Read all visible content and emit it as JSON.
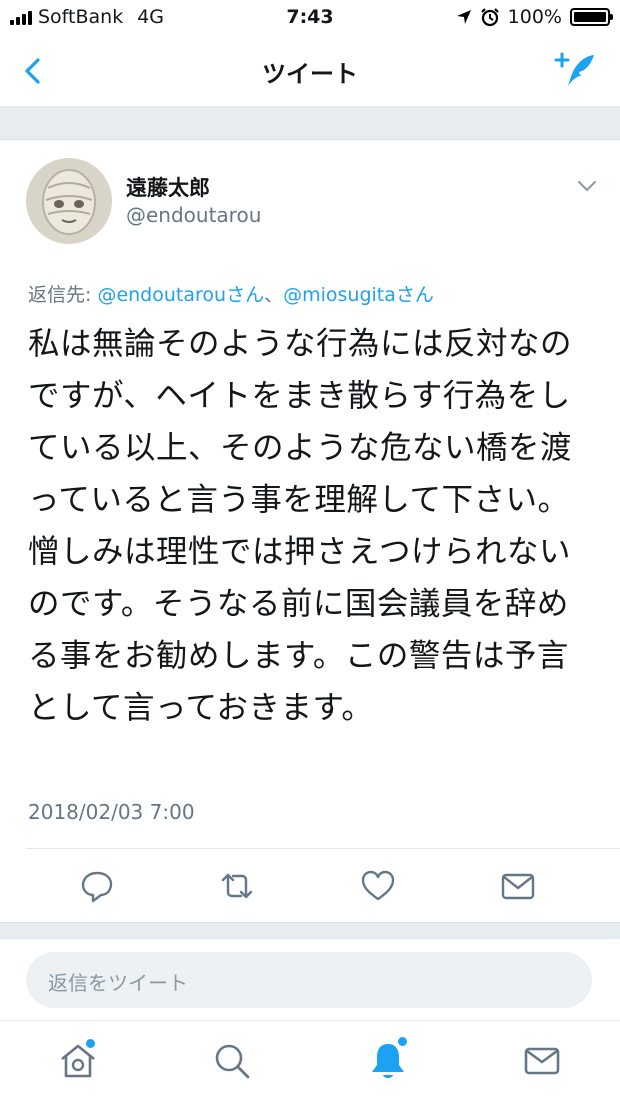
{
  "status_bar": {
    "carrier": "SoftBank",
    "network": "4G",
    "time": "7:43",
    "battery_text": "100%",
    "battery_level": 1.0
  },
  "nav": {
    "title": "ツイート",
    "back_icon": "chevron-left-icon",
    "compose_icon": "compose-tweet-icon"
  },
  "tweet": {
    "display_name": "遠藤太郎",
    "handle": "@endoutarou",
    "reply_to_label": "返信先: ",
    "reply_mention_1": "@endoutarouさん",
    "reply_sep": "、",
    "reply_mention_2": "@miosugitaさん",
    "text": "私は無論そのような行為には反対なのですが、ヘイトをまき散らす行為をしている以上、そのような危ない橋を渡っていると言う事を理解して下さい。憎しみは理性では押さえつけられないのです。そうなる前に国会議員を辞める事をお勧めします。この警告は予言として言っておきます。",
    "timestamp": "2018/02/03 7:00"
  },
  "actions": [
    "reply-icon",
    "retweet-icon",
    "like-icon",
    "direct-message-icon"
  ],
  "reply_box": {
    "placeholder": "返信をツイート"
  },
  "tab_bar": [
    "home-icon",
    "search-icon",
    "notifications-icon",
    "messages-icon"
  ],
  "colors": {
    "accent": "#1da1f2",
    "secondary_text": "#657786",
    "separator": "#e6ecf0"
  }
}
